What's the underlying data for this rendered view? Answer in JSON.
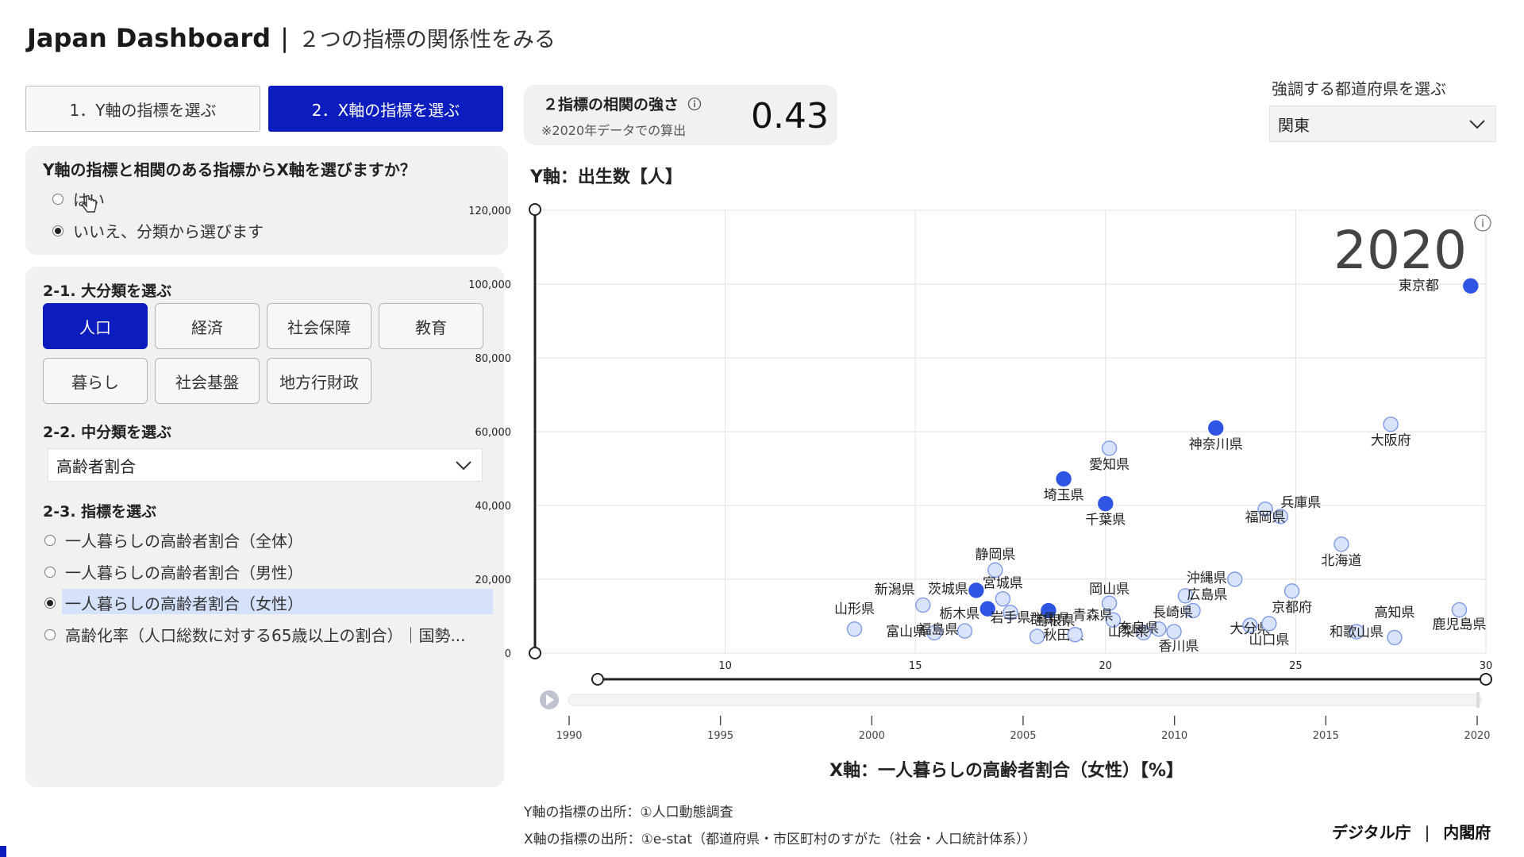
{
  "header": {
    "brand": "Japan Dashboard",
    "separator": "|",
    "subtitle": "２つの指標の関係性をみる"
  },
  "tabs": [
    {
      "label": "1．Y軸の指標を選ぶ",
      "active": false
    },
    {
      "label": "2．X軸の指標を選ぶ",
      "active": true
    }
  ],
  "correlation_question": {
    "text": "Y軸の指標と相関のある指標からX軸を選びますか？",
    "options": [
      {
        "label": "はい",
        "selected": false
      },
      {
        "label": "いいえ、分類から選びます",
        "selected": true
      }
    ]
  },
  "major_category": {
    "title": "2-1. 大分類を選ぶ",
    "buttons": [
      "人口",
      "経済",
      "社会保障",
      "教育",
      "暮らし",
      "社会基盤",
      "地方行財政"
    ],
    "selected": "人口"
  },
  "mid_category": {
    "title": "2-2. 中分類を選ぶ",
    "selected": "高齢者割合"
  },
  "indicator": {
    "title": "2-3. 指標を選ぶ",
    "options": [
      {
        "label": "一人暮らしの高齢者割合（全体）",
        "selected": false
      },
      {
        "label": "一人暮らしの高齢者割合（男性）",
        "selected": false
      },
      {
        "label": "一人暮らしの高齢者割合（女性）",
        "selected": true
      },
      {
        "label": "高齢化率（人口総数に対する65歳以上の割合）｜国勢...",
        "selected": false
      }
    ]
  },
  "correlation": {
    "label": "２指標の相関の強さ",
    "note": "※2020年データでの算出",
    "value": "0.43"
  },
  "highlight": {
    "label": "強調する都道府県を選ぶ",
    "selected": "関東"
  },
  "sources": {
    "y": "Y軸の指標の出所：①人口動態調査",
    "x": "X軸の指標の出所：①e-stat（都道府県・市区町村のすがた（社会・人口統計体系））"
  },
  "footer": {
    "org1": "デジタル庁",
    "separator": "|",
    "org2": "内閣府"
  },
  "colors": {
    "accent": "#0b1dbf",
    "point_fill": "#d9e3fb",
    "point_stroke": "#7f9ae8",
    "highlight_point": "#2f55e4"
  },
  "chart_data": {
    "type": "scatter",
    "ylabel": "Y軸：出生数【人】",
    "xlabel": "X軸：一人暮らしの高齢者割合（女性）【%】",
    "year": "2020",
    "xlim": [
      0,
      30
    ],
    "ylim": [
      0,
      120000
    ],
    "x_ticks": [
      "10",
      "15",
      "20",
      "25",
      "30"
    ],
    "y_ticks": [
      "0",
      "20,000",
      "40,000",
      "60,000",
      "80,000",
      "100,000",
      "120,000"
    ],
    "timeline_ticks": [
      "1990",
      "1995",
      "2000",
      "2005",
      "2010",
      "2015",
      "2020"
    ],
    "points": [
      {
        "name": "東京都",
        "x": 29.6,
        "y": 99500,
        "highlight": true
      },
      {
        "name": "大阪府",
        "x": 27.5,
        "y": 62000,
        "highlight": false
      },
      {
        "name": "神奈川県",
        "x": 22.9,
        "y": 61000,
        "highlight": true
      },
      {
        "name": "愛知県",
        "x": 20.1,
        "y": 55500,
        "highlight": false
      },
      {
        "name": "埼玉県",
        "x": 18.9,
        "y": 47200,
        "highlight": true
      },
      {
        "name": "千葉県",
        "x": 20.0,
        "y": 40500,
        "highlight": true
      },
      {
        "name": "兵庫県",
        "x": 24.6,
        "y": 37000,
        "highlight": false
      },
      {
        "name": "福岡県",
        "x": 24.2,
        "y": 39000,
        "highlight": false
      },
      {
        "name": "北海道",
        "x": 26.2,
        "y": 29500,
        "highlight": false
      },
      {
        "name": "静岡県",
        "x": 17.1,
        "y": 22500,
        "highlight": false
      },
      {
        "name": "茨城県",
        "x": 16.6,
        "y": 17000,
        "highlight": true
      },
      {
        "name": "宮城県",
        "x": 17.3,
        "y": 14700,
        "highlight": false
      },
      {
        "name": "新潟県",
        "x": 15.2,
        "y": 13000,
        "highlight": false
      },
      {
        "name": "栃木県",
        "x": 16.9,
        "y": 12000,
        "highlight": true
      },
      {
        "name": "岩手県",
        "x": 17.5,
        "y": 11000,
        "highlight": false
      },
      {
        "name": "群馬県",
        "x": 18.5,
        "y": 11500,
        "highlight": true
      },
      {
        "name": "岡山県",
        "x": 20.1,
        "y": 13500,
        "highlight": false
      },
      {
        "name": "沖縄県",
        "x": 23.4,
        "y": 20000,
        "highlight": false
      },
      {
        "name": "広島県",
        "x": 22.1,
        "y": 15500,
        "highlight": false
      },
      {
        "name": "京都府",
        "x": 24.9,
        "y": 16800,
        "highlight": false
      },
      {
        "name": "山形県",
        "x": 13.4,
        "y": 6500,
        "highlight": false
      },
      {
        "name": "富山県",
        "x": 15.5,
        "y": 5500,
        "highlight": false
      },
      {
        "name": "福島県",
        "x": 16.3,
        "y": 6000,
        "highlight": false
      },
      {
        "name": "秋田県",
        "x": 18.2,
        "y": 4500,
        "highlight": false
      },
      {
        "name": "島根県",
        "x": 19.2,
        "y": 5000,
        "highlight": false
      },
      {
        "name": "青森県",
        "x": 20.2,
        "y": 9000,
        "highlight": false
      },
      {
        "name": "山梨県",
        "x": 21.0,
        "y": 5500,
        "highlight": false
      },
      {
        "name": "奈良県",
        "x": 21.4,
        "y": 6500,
        "highlight": false
      },
      {
        "name": "長崎県",
        "x": 22.3,
        "y": 11500,
        "highlight": false
      },
      {
        "name": "香川県",
        "x": 21.8,
        "y": 5800,
        "highlight": false
      },
      {
        "name": "大分県",
        "x": 23.8,
        "y": 7500,
        "highlight": false
      },
      {
        "name": "山口県",
        "x": 24.3,
        "y": 8000,
        "highlight": false
      },
      {
        "name": "高知県",
        "x": 27.6,
        "y": 4200,
        "highlight": false
      },
      {
        "name": "和歌山県",
        "x": 26.6,
        "y": 5800,
        "highlight": false
      },
      {
        "name": "鹿児島県",
        "x": 29.3,
        "y": 11700,
        "highlight": false
      }
    ]
  }
}
